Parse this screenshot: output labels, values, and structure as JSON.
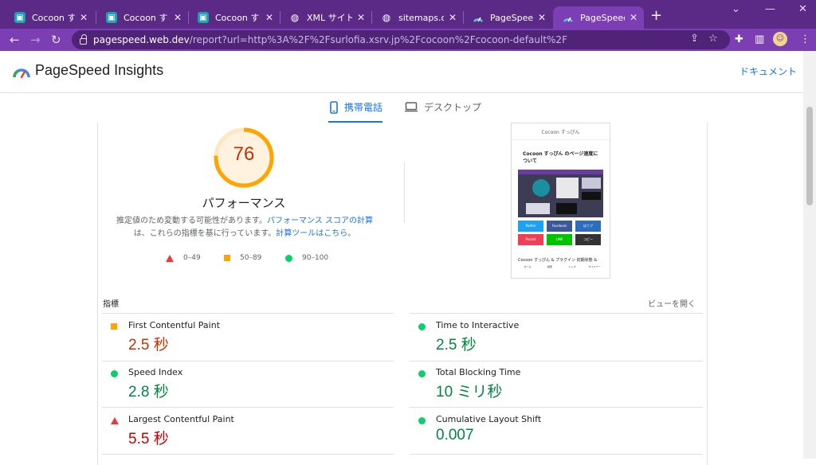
{
  "browser": {
    "tabs": [
      {
        "title": "Cocoon すっぴん",
        "icon": "cocoon-favicon",
        "active": false
      },
      {
        "title": "Cocoon すっぴん",
        "icon": "cocoon-favicon",
        "active": false
      },
      {
        "title": "Cocoon すっぴん",
        "icon": "cocoon-favicon",
        "active": false
      },
      {
        "title": "XML サイトマップ",
        "icon": "globe-icon",
        "active": false
      },
      {
        "title": "sitemaps.org -",
        "icon": "globe-icon",
        "active": false
      },
      {
        "title": "PageSpeed Insi",
        "icon": "pagespeed-favicon",
        "active": false
      },
      {
        "title": "PageSpeed Insi",
        "icon": "pagespeed-favicon",
        "active": true
      }
    ],
    "new_tab": "+",
    "address": {
      "host": "pagespeed.web.dev",
      "path": "/report?url=http%3A%2F%2Fsurlofia.xsrv.jp%2Fcocoon%2Fcocoon-default%2F"
    },
    "colors": {
      "frame": "#5b2a86",
      "toolbar": "#7b3fb3"
    }
  },
  "header": {
    "brand": "PageSpeed Insights",
    "docs_link": "ドキュメント"
  },
  "device_tabs": [
    {
      "label": "携帯電話",
      "icon": "phone-icon",
      "active": true
    },
    {
      "label": "デスクトップ",
      "icon": "desktop-icon",
      "active": false
    }
  ],
  "score": {
    "value": "76",
    "fraction": 0.76,
    "title": "パフォーマンス",
    "desc_line1": "推定値のため変動する可能性があります。",
    "desc_link1": "パフォーマンス スコアの計算",
    "desc_line2": "は、これらの指標を基に行っています。",
    "desc_link2": "計算ツールはこちら",
    "desc_end": "。",
    "color": "#ffa400"
  },
  "legend": [
    {
      "range": "0–49",
      "icon": "red-triangle"
    },
    {
      "range": "50–89",
      "icon": "orange-square"
    },
    {
      "range": "90–100",
      "icon": "green-circle"
    }
  ],
  "screenshot": {
    "site_name": "Cocoon すっぴん",
    "title": "Cocoon すっぴん のページ速度について",
    "buttons": [
      "Twitter",
      "Facebook",
      "はてブ",
      "Pocket",
      "LINE",
      "コピー"
    ],
    "footer_text": "Cocoon すっぴん & プラグイン 初期状態 &",
    "nav": [
      "ホーム",
      "検索",
      "トップ",
      "サイドバー"
    ]
  },
  "metrics": {
    "label": "指標",
    "expand": "ビューを開く",
    "items": [
      {
        "name": "First Contentful Paint",
        "value": "2.5 秒",
        "rating": "orange"
      },
      {
        "name": "Time to Interactive",
        "value": "2.5 秒",
        "rating": "green"
      },
      {
        "name": "Speed Index",
        "value": "2.8 秒",
        "rating": "green"
      },
      {
        "name": "Total Blocking Time",
        "value": "10 ミリ秒",
        "rating": "green"
      },
      {
        "name": "Largest Contentful Paint",
        "value": "5.5 秒",
        "rating": "red"
      },
      {
        "name": "Cumulative Layout Shift",
        "value": "0.007",
        "rating": "green"
      }
    ]
  }
}
